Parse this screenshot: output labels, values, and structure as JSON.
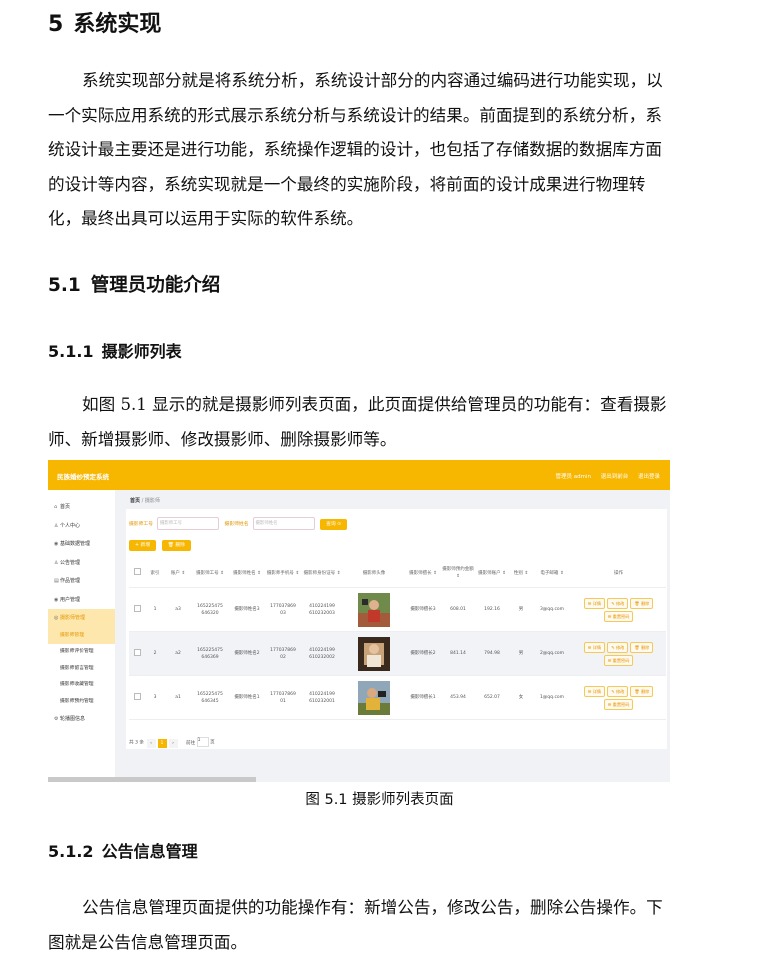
{
  "doc": {
    "h1_num": "5",
    "h1_title": "系统实现",
    "intro": "系统实现部分就是将系统分析，系统设计部分的内容通过编码进行功能实现，以一个实际应用系统的形式展示系统分析与系统设计的结果。前面提到的系统分析，系统设计最主要还是进行功能，系统操作逻辑的设计，也包括了存储数据的数据库方面的设计等内容，系统实现就是一个最终的实施阶段，将前面的设计成果进行物理转化，最终出具可以运用于实际的软件系统。",
    "h2_num": "5.1",
    "h2_title": "管理员功能介绍",
    "h3a_num": "5.1.1",
    "h3a_title": "摄影师列表",
    "para_a": "如图 5.1 显示的就是摄影师列表页面，此页面提供给管理员的功能有：查看摄影师、新增摄影师、修改摄影师、删除摄影师等。",
    "caption": "图 5.1  摄影师列表页面",
    "h3b_num": "5.1.2",
    "h3b_title": "公告信息管理",
    "para_b": "公告信息管理页面提供的功能操作有：新增公告，修改公告，删除公告操作。下图就是公告信息管理页面。"
  },
  "screenshot": {
    "brand": "民族婚纱预定系统",
    "top_links": [
      "管理员 admin",
      "退出到前台",
      "退出登录"
    ],
    "menu": [
      {
        "icon": "home-icon",
        "glyph": "⌂",
        "label": "首页"
      },
      {
        "icon": "user-icon",
        "glyph": "♙",
        "label": "个人中心"
      },
      {
        "icon": "pin-icon",
        "glyph": "◉",
        "label": "基础数据管理"
      },
      {
        "icon": "user-icon",
        "glyph": "♙",
        "label": "公告管理"
      },
      {
        "icon": "folder-icon",
        "glyph": "▤",
        "label": "作品管理"
      },
      {
        "icon": "pin-icon",
        "glyph": "◉",
        "label": "用户管理"
      },
      {
        "icon": "camera-icon",
        "glyph": "◎",
        "label": "摄影师管理"
      }
    ],
    "submenu": [
      "摄影师管理",
      "摄影师评价管理",
      "摄影师留言管理",
      "摄影师收藏管理",
      "摄影师预约管理"
    ],
    "last_menu": {
      "icon": "gear-icon",
      "glyph": "⚙",
      "label": "轮播图信息"
    },
    "breadcrumb_home": "首页",
    "breadcrumb_sep": "/",
    "breadcrumb_current": "摄影师",
    "search_label_1": "摄影师工号",
    "search_placeholder_1": "摄影师工号",
    "search_label_2": "摄影师姓名",
    "search_placeholder_2": "摄影师姓名",
    "search_button": "查询 ⊙",
    "add_button": "+ 新增",
    "delete_button": "🗑 删除",
    "columns": [
      "",
      "索引",
      "账户 ⇕",
      "摄影师工号 ⇕",
      "摄影师姓名 ⇕",
      "摄影师手机号 ⇕",
      "摄影师身份证号 ⇕",
      "摄影师头像",
      "摄影师擅长 ⇕",
      "摄影师预约金额 ⇕",
      "摄影师账户 ⇕",
      "性别 ⇕",
      "电子邮箱 ⇕",
      "操作"
    ],
    "rows": [
      {
        "idx": "1",
        "acct": "a3",
        "no": "165225475\n646320",
        "name": "摄影师姓名3",
        "phone": "177037869\n03",
        "id": "410224199\n610232003",
        "skill": "摄影师擅长3",
        "price": "608.01",
        "balance": "192.16",
        "sex": "男",
        "email": "3@qq.com"
      },
      {
        "idx": "2",
        "acct": "a2",
        "no": "165225475\n646369",
        "name": "摄影师姓名2",
        "phone": "177037869\n02",
        "id": "410224199\n610232002",
        "skill": "摄影师擅长2",
        "price": "841.14",
        "balance": "794.98",
        "sex": "男",
        "email": "2@qq.com"
      },
      {
        "idx": "3",
        "acct": "a1",
        "no": "165225475\n646345",
        "name": "摄影师姓名1",
        "phone": "177037869\n01",
        "id": "410224199\n610232001",
        "skill": "摄影师擅长1",
        "price": "453.94",
        "balance": "652.07",
        "sex": "女",
        "email": "1@qq.com"
      }
    ],
    "row_actions": [
      "☰ 详情",
      "✎ 修改",
      "🗑 删除",
      "☰ 重置密码"
    ],
    "pager_total": "共 3 条",
    "pager_prev": "‹",
    "pager_page": "1",
    "pager_next": "›",
    "pager_goto": "前往",
    "pager_goto_val": "1",
    "pager_unit": "页"
  }
}
